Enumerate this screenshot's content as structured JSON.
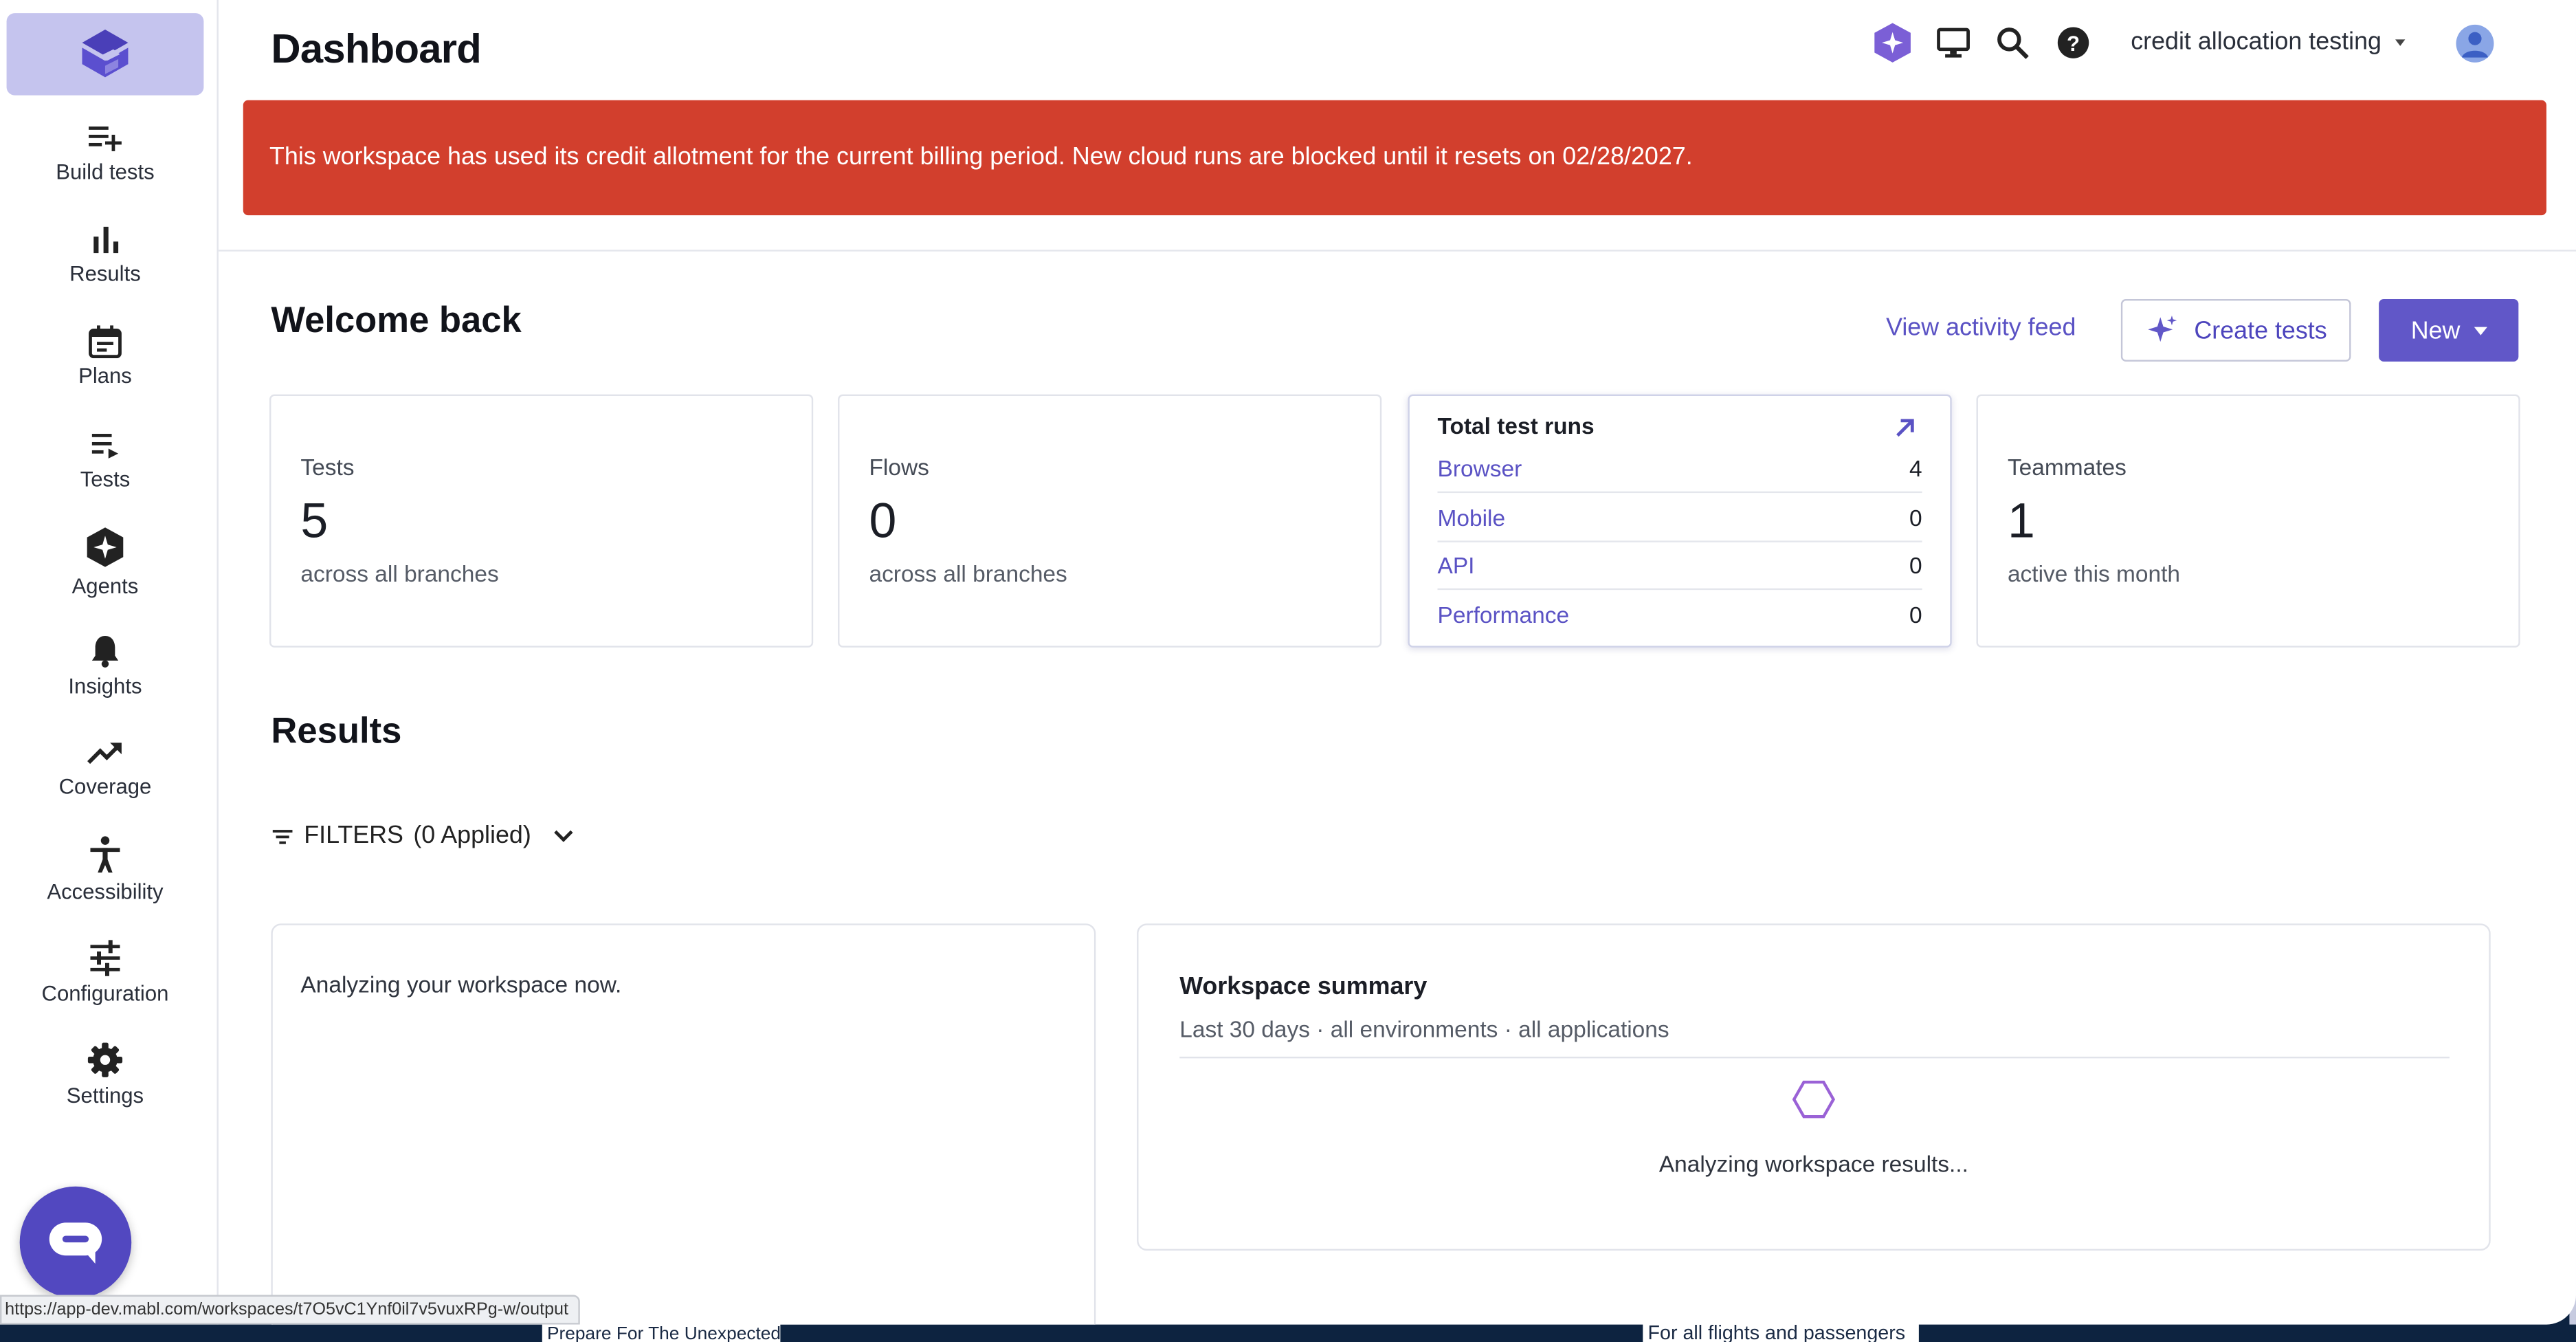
{
  "app": {
    "page_title": "Dashboard",
    "workspace_name": "credit allocation testing"
  },
  "sidebar": {
    "items": [
      {
        "label": "Build tests",
        "icon": "build-tests-icon"
      },
      {
        "label": "Results",
        "icon": "bar-chart-icon"
      },
      {
        "label": "Plans",
        "icon": "calendar-icon"
      },
      {
        "label": "Tests",
        "icon": "list-icon"
      },
      {
        "label": "Agents",
        "icon": "agents-icon"
      },
      {
        "label": "Insights",
        "icon": "bell-icon"
      },
      {
        "label": "Coverage",
        "icon": "trending-up-icon"
      },
      {
        "label": "Accessibility",
        "icon": "accessibility-icon"
      },
      {
        "label": "Configuration",
        "icon": "sliders-icon"
      },
      {
        "label": "Settings",
        "icon": "gear-icon"
      }
    ]
  },
  "banner": {
    "text": "This workspace has used its credit allotment for the current billing period. New cloud runs are blocked until it resets on 02/28/2027."
  },
  "welcome": {
    "title": "Welcome back",
    "activity_link": "View activity feed",
    "create_button": "Create tests",
    "new_button": "New"
  },
  "cards": {
    "tests": {
      "label": "Tests",
      "value": "5",
      "sub": "across all branches"
    },
    "flows": {
      "label": "Flows",
      "value": "0",
      "sub": "across all branches"
    },
    "runs": {
      "title": "Total test runs",
      "rows": [
        {
          "name": "Browser",
          "value": "4"
        },
        {
          "name": "Mobile",
          "value": "0"
        },
        {
          "name": "API",
          "value": "0"
        },
        {
          "name": "Performance",
          "value": "0"
        }
      ]
    },
    "teammates": {
      "label": "Teammates",
      "value": "1",
      "sub": "active this month"
    }
  },
  "results": {
    "title": "Results",
    "filters_label": "FILTERS",
    "filters_count": "(0 Applied)",
    "left_panel_text": "Analyzing your workspace now.",
    "summary": {
      "title": "Workspace summary",
      "subtitle": "Last 30 days · all environments · all applications",
      "message": "Analyzing workspace results..."
    }
  },
  "status_bar": {
    "url": "https://app-dev.mabl.com/workspaces/t7O5vC1Ynf0il7v5vuxRPg-w/output"
  },
  "background": {
    "text_left": "Prepare For The Unexpected",
    "text_right": "For all flights and passengers"
  },
  "colors": {
    "accent": "#6157c8",
    "link": "#5a52c4",
    "banner": "#d23f2d",
    "sidebar_tile": "#c5c4ee"
  }
}
